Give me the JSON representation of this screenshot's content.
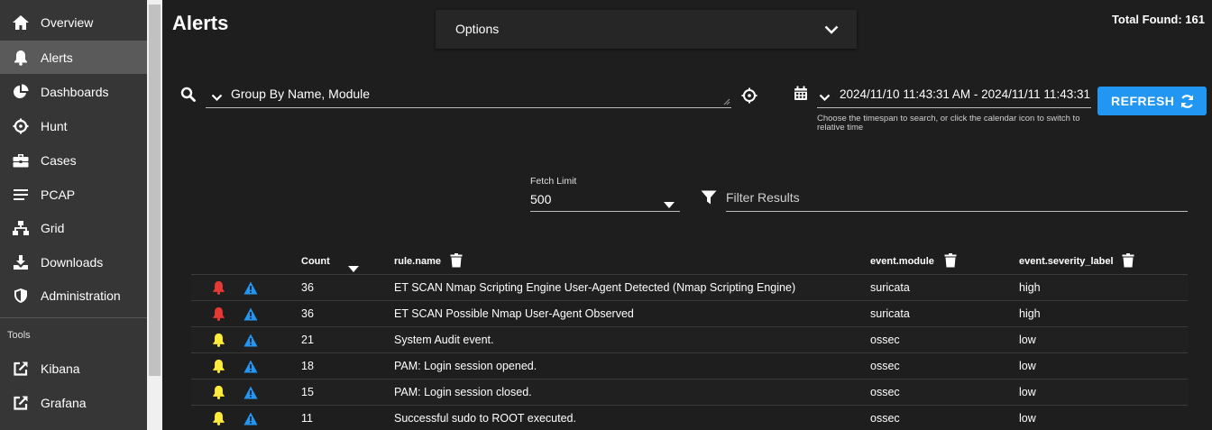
{
  "sidebar": {
    "items": [
      {
        "label": "Overview",
        "icon": "home-icon"
      },
      {
        "label": "Alerts",
        "icon": "bell-icon",
        "active": true
      },
      {
        "label": "Dashboards",
        "icon": "pie-chart-icon"
      },
      {
        "label": "Hunt",
        "icon": "crosshair-icon"
      },
      {
        "label": "Cases",
        "icon": "briefcase-icon"
      },
      {
        "label": "PCAP",
        "icon": "list-icon"
      },
      {
        "label": "Grid",
        "icon": "sitemap-icon"
      },
      {
        "label": "Downloads",
        "icon": "download-icon"
      },
      {
        "label": "Administration",
        "icon": "shield-icon"
      }
    ],
    "tools_label": "Tools",
    "tools": [
      {
        "label": "Kibana",
        "icon": "external-link-icon"
      },
      {
        "label": "Grafana",
        "icon": "external-link-icon"
      }
    ]
  },
  "header": {
    "title": "Alerts",
    "options_label": "Options",
    "total_found": "Total Found: 161"
  },
  "query": {
    "group_by": "Group By Name, Module",
    "date_range": "2024/11/10 11:43:31 AM - 2024/11/11 11:43:31 AM",
    "date_hint": "Choose the timespan to search, or click the calendar icon to switch to relative time",
    "refresh_label": "REFRESH"
  },
  "fetch": {
    "label": "Fetch Limit",
    "value": "500"
  },
  "filter": {
    "placeholder": "Filter Results"
  },
  "table": {
    "headers": {
      "count": "Count",
      "rule_name": "rule.name",
      "event_module": "event.module",
      "severity": "event.severity_label"
    },
    "rows": [
      {
        "count": "36",
        "rule_name": "ET SCAN Nmap Scripting Engine User-Agent Detected (Nmap Scripting Engine)",
        "module": "suricata",
        "severity": "high"
      },
      {
        "count": "36",
        "rule_name": "ET SCAN Possible Nmap User-Agent Observed",
        "module": "suricata",
        "severity": "high"
      },
      {
        "count": "21",
        "rule_name": "System Audit event.",
        "module": "ossec",
        "severity": "low"
      },
      {
        "count": "18",
        "rule_name": "PAM: Login session opened.",
        "module": "ossec",
        "severity": "low"
      },
      {
        "count": "15",
        "rule_name": "PAM: Login session closed.",
        "module": "ossec",
        "severity": "low"
      },
      {
        "count": "11",
        "rule_name": "Successful sudo to ROOT executed.",
        "module": "ossec",
        "severity": "low"
      }
    ]
  },
  "colors": {
    "accent": "#2196f3",
    "high": "#e53935",
    "low": "#ffeb3b",
    "warn": "#2196f3"
  }
}
